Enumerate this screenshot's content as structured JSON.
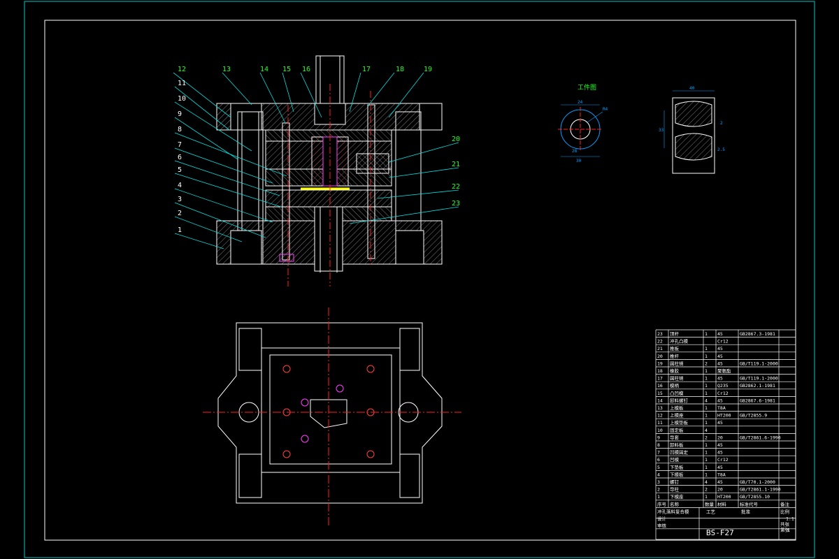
{
  "drawing": {
    "drawing_number": "BS-F27",
    "colors": {
      "background": "#000000",
      "frame": "#00c8c8",
      "outline": "#ffffff",
      "hatch": "#b0b0b0",
      "centerline": "#ff2020",
      "leader": "#00e0e0",
      "balloon": "#20ff20",
      "part_dim": "#00a0ff",
      "highlight": "#ffff00"
    }
  },
  "balloons_top": [
    "12",
    "13",
    "14",
    "15",
    "16",
    "17",
    "18",
    "19"
  ],
  "balloons_left": [
    "11",
    "10",
    "9",
    "8",
    "7",
    "6",
    "5",
    "4",
    "3",
    "2",
    "1"
  ],
  "balloons_right": [
    "20",
    "21",
    "22",
    "23"
  ],
  "workpiece": {
    "title": "工件图",
    "dims": [
      "24",
      "R4",
      "28",
      "30"
    ],
    "side_dims": [
      "40",
      "33",
      "2",
      "2.5"
    ]
  },
  "bom": {
    "rows": [
      [
        "23",
        "顶杆",
        "1",
        "45",
        "GB2867.3-1981"
      ],
      [
        "22",
        "冲孔凸模",
        "",
        "Cr12",
        ""
      ],
      [
        "21",
        "推板",
        "1",
        "45",
        ""
      ],
      [
        "20",
        "推杆",
        "1",
        "45",
        ""
      ],
      [
        "19",
        "圆柱销",
        "2",
        "45",
        "GB/T119.1-2000"
      ],
      [
        "18",
        "橡胶",
        "1",
        "聚氨酯",
        ""
      ],
      [
        "17",
        "圆柱销",
        "1",
        "45",
        "GB/T119.1-2000"
      ],
      [
        "16",
        "模柄",
        "1",
        "Q235",
        "GB2862.1-1981"
      ],
      [
        "15",
        "凸凹模",
        "1",
        "Cr12",
        ""
      ],
      [
        "14",
        "卸料螺钉",
        "4",
        "45",
        "GB2867.6-1981"
      ],
      [
        "13",
        "上模板",
        "1",
        "T8A",
        ""
      ],
      [
        "12",
        "上模座",
        "1",
        "HT200",
        "GB/T2855.9"
      ],
      [
        "11",
        "上模垫板",
        "1",
        "45",
        ""
      ],
      [
        "10",
        "固定板",
        "4",
        "",
        ""
      ],
      [
        "9",
        "导套",
        "2",
        "20",
        "GB/T2861.6-1990"
      ],
      [
        "8",
        "卸料板",
        "1",
        "45",
        ""
      ],
      [
        "7",
        "凹模固定",
        "1",
        "45",
        ""
      ],
      [
        "6",
        "凹模",
        "1",
        "Cr12",
        ""
      ],
      [
        "5",
        "下垫板",
        "1",
        "45",
        ""
      ],
      [
        "4",
        "下模板",
        "1",
        "T8A",
        ""
      ],
      [
        "3",
        "螺钉",
        "4",
        "45",
        "GB/T70.1-2000"
      ],
      [
        "2",
        "导柱",
        "2",
        "20",
        "GB/T2861.1-1990"
      ],
      [
        "1",
        "下模座",
        "1",
        "HT200",
        "GB/T2855.10"
      ]
    ],
    "header": [
      "序号",
      "名称",
      "数量",
      "材料",
      "标准代号",
      "备注"
    ],
    "title_rows": [
      "冲孔落料复合模",
      "比例",
      "1:1",
      "设计",
      "审核",
      "工艺",
      "批准",
      "共张",
      "第张",
      "1"
    ]
  }
}
